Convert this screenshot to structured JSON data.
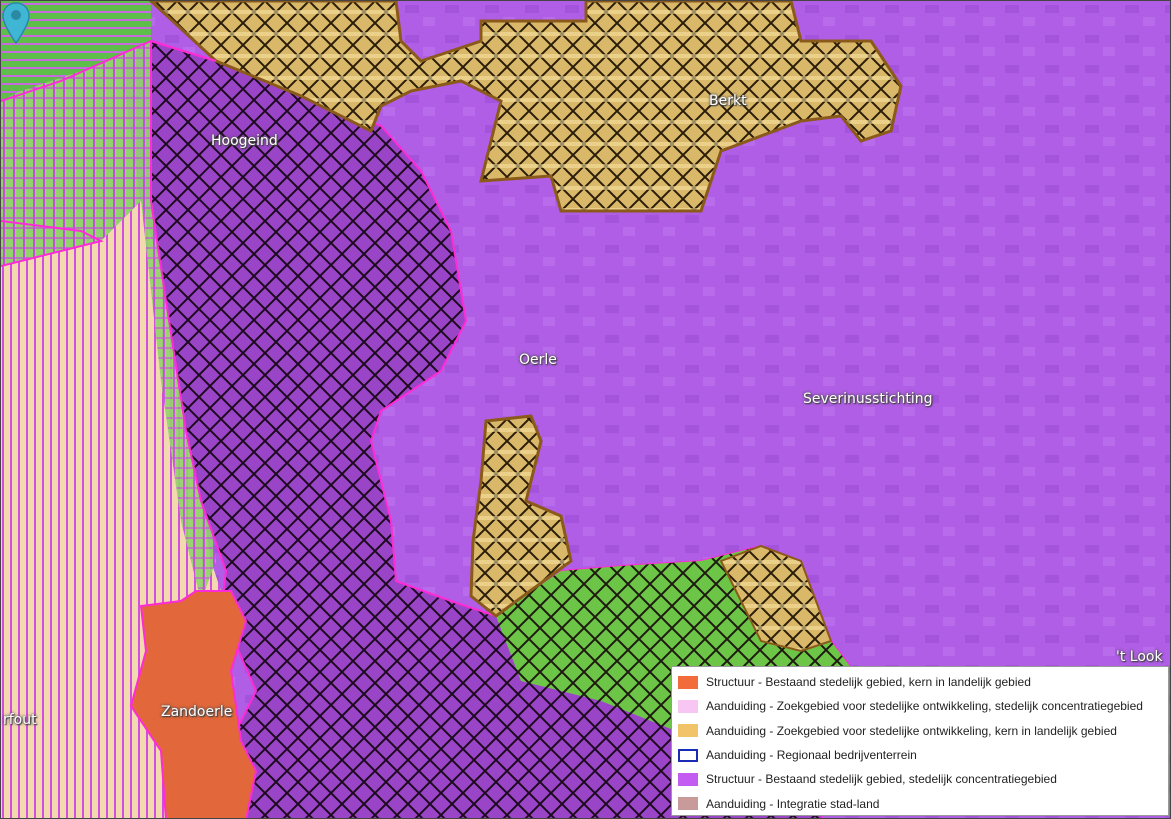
{
  "map": {
    "place_labels": {
      "hoogeind": "Hoogeind",
      "berkt": "Berkt",
      "oerle": "Oerle",
      "severinusstichting": "Severinusstichting",
      "zandoerle": "Zandoerle",
      "t_look": "'t Look",
      "rfout": "rfout"
    },
    "marker": {
      "icon": "map-pin-icon",
      "color": "#3fb6d4"
    }
  },
  "legend": {
    "items": [
      {
        "label": "Structuur - Bestaand stedelijk gebied, kern in landelijk gebied",
        "color": "#f26b3a",
        "outline": false
      },
      {
        "label": "Aanduiding - Zoekgebied voor stedelijke ontwikkeling, stedelijk concentratiegebied",
        "color": "#f7c6f2",
        "outline": false
      },
      {
        "label": "Aanduiding - Zoekgebied voor stedelijke ontwikkeling, kern in landelijk gebied",
        "color": "#f2c469",
        "outline": false
      },
      {
        "label": "Aanduiding - Regionaal bedrijventerrein",
        "color": "#1a2bb5",
        "outline": true
      },
      {
        "label": "Structuur - Bestaand stedelijk gebied, stedelijk concentratiegebied",
        "color": "#c35cf0",
        "outline": false
      },
      {
        "label": "Aanduiding - Integratie stad-land",
        "color": "#c99a9a",
        "outline": false
      }
    ]
  }
}
